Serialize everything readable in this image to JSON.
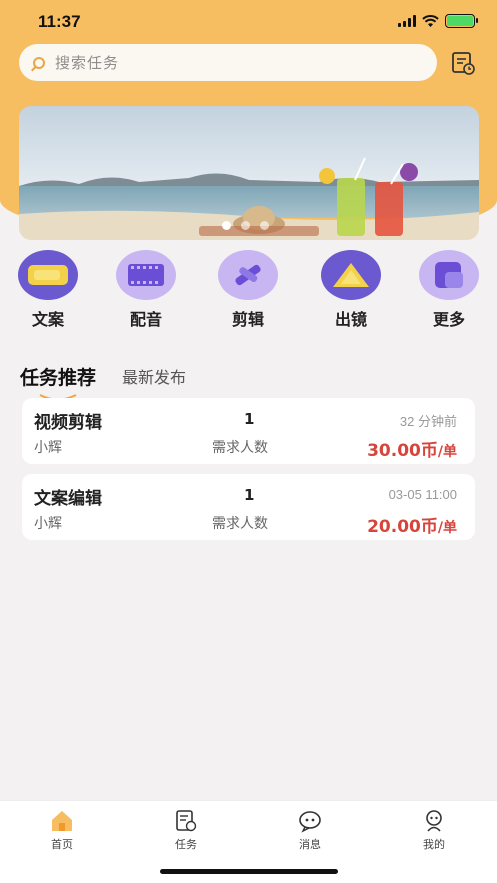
{
  "status_bar": {
    "time": "11:37"
  },
  "search": {
    "placeholder": "搜索任务"
  },
  "categories": [
    {
      "label": "文案",
      "icon": "document-icon"
    },
    {
      "label": "配音",
      "icon": "film-icon"
    },
    {
      "label": "剪辑",
      "icon": "scissors-icon"
    },
    {
      "label": "出镜",
      "icon": "mountain-icon"
    },
    {
      "label": "更多",
      "icon": "grid-icon"
    }
  ],
  "tabs": {
    "active": "任务推荐",
    "inactive": "最新发布"
  },
  "tasks": [
    {
      "title": "视频剪辑",
      "author": "小辉",
      "count": "1",
      "count_label": "需求人数",
      "time": "32 分钟前",
      "price": "30.00币",
      "unit": "/单"
    },
    {
      "title": "文案编辑",
      "author": "小辉",
      "count": "1",
      "count_label": "需求人数",
      "time": "03-05 11:00",
      "price": "20.00币",
      "unit": "/单"
    }
  ],
  "tabbar": [
    {
      "label": "首页",
      "icon": "home-icon",
      "active": true
    },
    {
      "label": "任务",
      "icon": "task-icon",
      "active": false
    },
    {
      "label": "消息",
      "icon": "message-icon",
      "active": false
    },
    {
      "label": "我的",
      "icon": "profile-icon",
      "active": false
    }
  ],
  "colors": {
    "accent": "#f6bd61",
    "price": "#d6453b",
    "category_bg": "#c7b6f2",
    "category_fg": "#6a4ed6"
  }
}
